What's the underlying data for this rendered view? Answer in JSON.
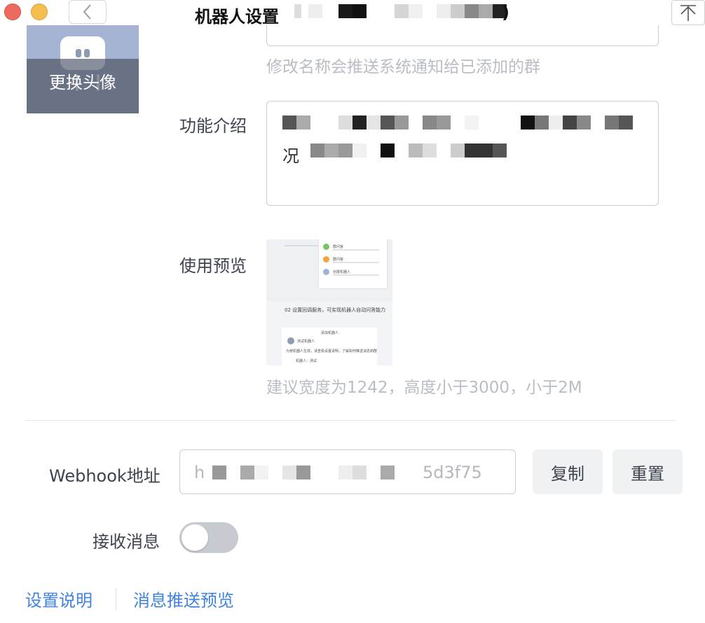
{
  "window": {
    "title_prefix": "机器人设置",
    "title_suffix": ")"
  },
  "avatar": {
    "change_label": "更换头像"
  },
  "name": {
    "hint": "修改名称会推送系统通知给已添加的群"
  },
  "description": {
    "label": "功能介绍",
    "line2_start": "况"
  },
  "preview": {
    "label": "使用预览",
    "thumb": {
      "item1": "群问答",
      "item2": "群问答",
      "item3": "创建机器人",
      "heading": "02 设置回调服务，可实现机器人自动问答能力",
      "panel_title": "添加机器人",
      "bot_name": "测试机器人",
      "panel_text": "为使机器人生效，请查看设置说明，了解如何推送消息到群",
      "field": "机器人：测试"
    },
    "hint": "建议宽度为1242，高度小于3000，小于2M"
  },
  "webhook": {
    "label": "Webhook地址",
    "value_start": "h",
    "value_end": "5d3f75",
    "copy_label": "复制",
    "reset_label": "重置"
  },
  "receive": {
    "label": "接收消息",
    "enabled": false
  },
  "links": {
    "setup_guide": "设置说明",
    "push_preview": "消息推送预览"
  },
  "colors": {
    "link": "#3f83e0",
    "toggle_off": "#c7cad0",
    "close": "#ee6a5e",
    "minimize": "#f5bf4f"
  }
}
